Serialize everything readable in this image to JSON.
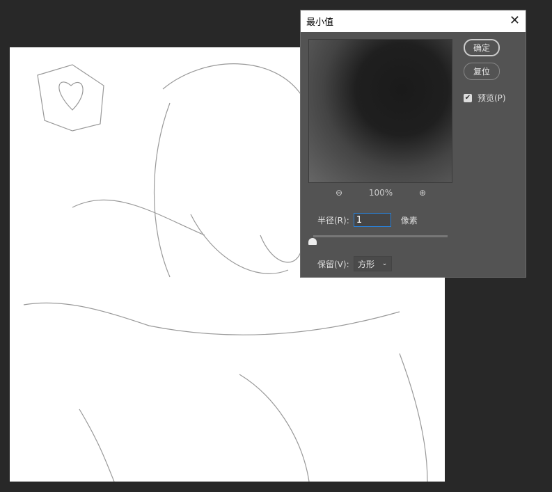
{
  "dialog": {
    "title": "最小值",
    "ok": "确定",
    "reset": "复位",
    "preview_label": "预览(P)",
    "preview_checked": true,
    "zoom_level": "100%",
    "radius_label": "半径(R):",
    "radius_value": "1",
    "radius_unit": "像素",
    "radius_slider_fraction": 0.0,
    "preserve_label": "保留(V):",
    "preserve_value": "方形"
  }
}
